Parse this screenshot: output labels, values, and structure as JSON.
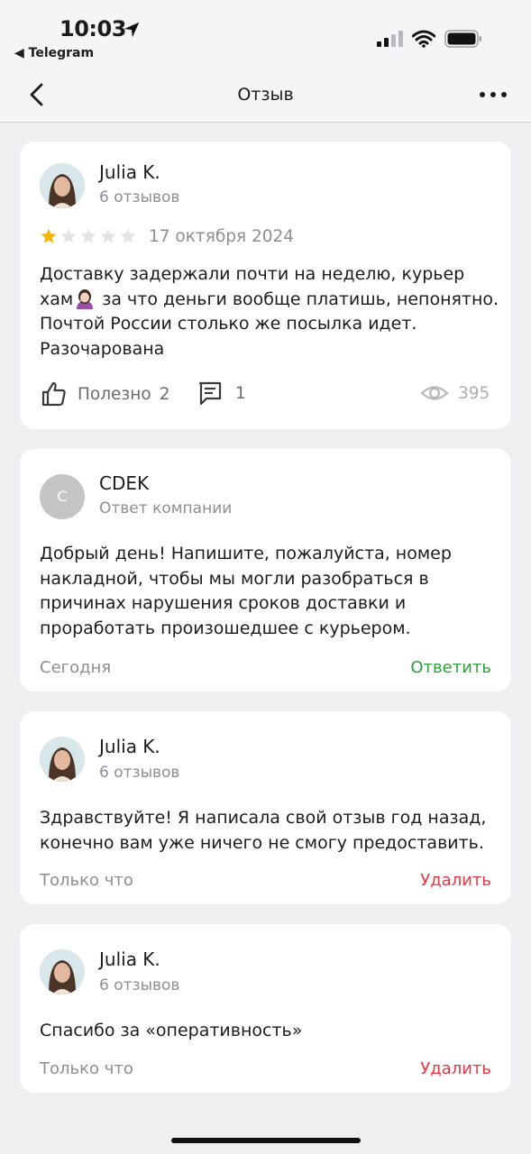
{
  "status_bar": {
    "time": "10:03",
    "back_app": "◀ Telegram",
    "icons": [
      "location-arrow-icon",
      "signal-icon",
      "wifi-icon",
      "battery-icon"
    ]
  },
  "nav": {
    "title": "Отзыв",
    "back_icon": "chevron-left-icon",
    "more_icon": "more-horizontal-icon"
  },
  "review": {
    "author": "Julia K.",
    "reviews_count": "6 отзывов",
    "rating": 1,
    "max_rating": 5,
    "date": "17 октября 2024",
    "text_part1": "Доставку задержали почти на неделю, курьер хам",
    "emoji": "woman-facepalming-emoji",
    "text_part2": " за что деньги вообще платишь, непонятно. Почтой России столько же посылка идет. Разочарована",
    "helpful_label": "Полезно",
    "helpful_count": "2",
    "comments_count": "1",
    "views_count": "395"
  },
  "company_reply": {
    "avatar_letter": "C",
    "author": "CDEK",
    "subtitle": "Ответ компании",
    "text": "Добрый день! Напишите, пожалуйста, номер накладной, чтобы мы могли разобраться в причинах нарушения сроков доставки и проработать произошедшее с курьером.",
    "time": "Сегодня",
    "action": "Ответить"
  },
  "replies": [
    {
      "author": "Julia K.",
      "reviews_count": "6 отзывов",
      "text": "Здравствуйте! Я написала свой отзыв год назад, конечно вам уже ничего не смогу предоставить.",
      "time": "Только что",
      "action": "Удалить"
    },
    {
      "author": "Julia K.",
      "reviews_count": "6 отзывов",
      "text": "Спасибо за «оперативность»",
      "time": "Только что",
      "action": "Удалить"
    }
  ],
  "colors": {
    "background": "#efeff1",
    "card": "#ffffff",
    "star_filled": "#f4b400",
    "star_empty": "#e3e3e6",
    "reply_green": "#2e9e3c",
    "delete_red": "#e43845",
    "muted": "#8e8e93"
  }
}
